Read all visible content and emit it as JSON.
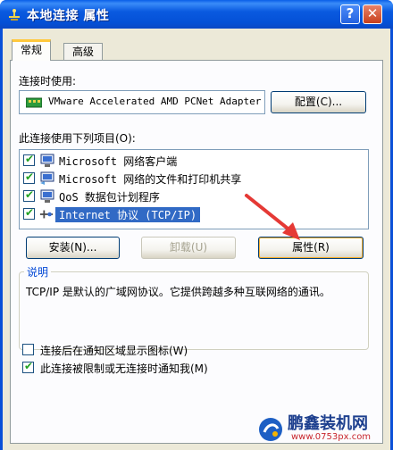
{
  "window": {
    "title": "本地连接 属性",
    "help_glyph": "?",
    "close_glyph": "✕"
  },
  "tabs": [
    {
      "label": "常规",
      "active": true
    },
    {
      "label": "高级",
      "active": false
    }
  ],
  "connect_using": {
    "label": "连接时使用:",
    "adapter_name": "VMware Accelerated AMD PCNet Adapter",
    "configure_button": "配置(C)..."
  },
  "components": {
    "label": "此连接使用下列项目(O):",
    "items": [
      {
        "label": "Microsoft 网络客户端",
        "checked": true,
        "icon": "network-client-icon"
      },
      {
        "label": "Microsoft 网络的文件和打印机共享",
        "checked": true,
        "icon": "file-printer-share-icon"
      },
      {
        "label": "QoS 数据包计划程序",
        "checked": true,
        "icon": "qos-scheduler-icon"
      },
      {
        "label": "Internet 协议 (TCP/IP)",
        "checked": true,
        "icon": "protocol-icon",
        "selected": true
      }
    ]
  },
  "buttons": {
    "install": "安装(N)...",
    "uninstall": "卸载(U)",
    "properties": "属性(R)"
  },
  "description": {
    "title": "说明",
    "text": "TCP/IP 是默认的广域网协议。它提供跨越多种互联网络的通讯。"
  },
  "options": [
    {
      "label": "连接后在通知区域显示图标(W)",
      "checked": false
    },
    {
      "label": "此连接被限制或无连接时通知我(M)",
      "checked": true
    }
  ],
  "watermark": {
    "title": "鹏鑫装机网",
    "url": "www.0753px.com"
  },
  "colors": {
    "titlebar": "#0a50d8",
    "dialog_bg": "#ece9d8",
    "selection": "#316ac5",
    "arrow": "#e53935"
  }
}
